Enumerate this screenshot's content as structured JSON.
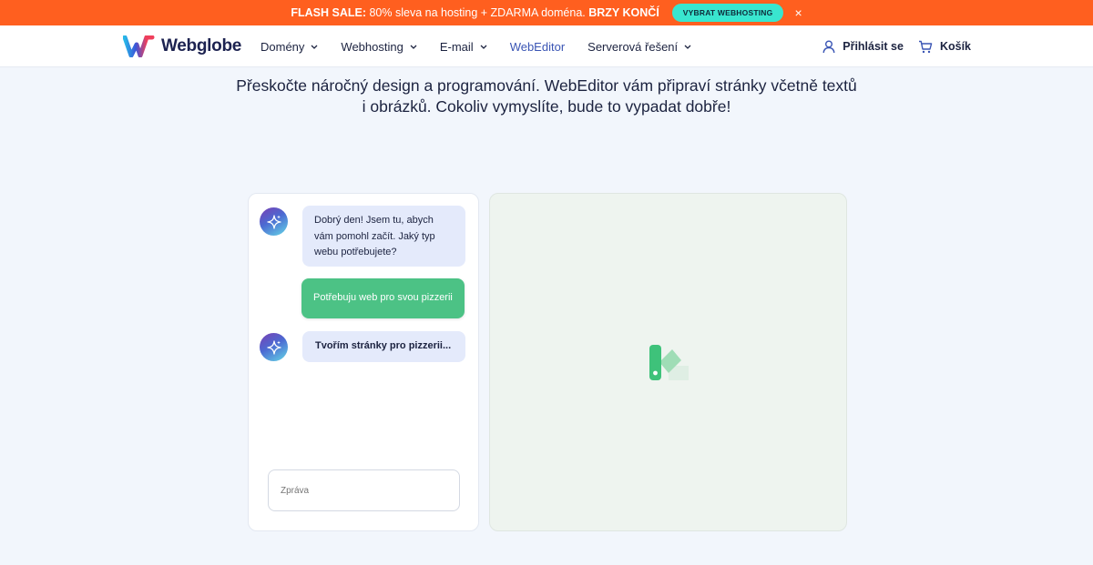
{
  "promo": {
    "text_bold_start": "FLASH SALE:",
    "text_middle": " 80% sleva na hosting + ZDARMA doména. ",
    "text_bold_end": "BRZY KONČÍ",
    "cta_label": "VYBRAT WEBHOSTING",
    "close_label": "×"
  },
  "header": {
    "logo_text": "Webglobe",
    "nav": [
      {
        "label": "Domény"
      },
      {
        "label": "Webhosting"
      },
      {
        "label": "E-mail"
      },
      {
        "label": "WebEditor"
      },
      {
        "label": "Serverová řešení"
      }
    ],
    "login_label": "Přihlásit se",
    "cart_label": "Košík"
  },
  "hero": {
    "line1": "Přeskočte náročný design a programování. WebEditor vám připraví stránky včetně textů",
    "line2": "i obrázků. Cokoliv vymyslíte, bude to vypadat dobře!"
  },
  "chat": {
    "messages": [
      {
        "role": "bot",
        "text": "Dobrý den! Jsem tu, abych vám pomohl začít. Jaký typ webu potřebujete?"
      },
      {
        "role": "user",
        "text": "Potřebuju web pro svou pizzerii"
      },
      {
        "role": "bot",
        "text": "Tvořím stránky pro pizzerii..."
      }
    ],
    "input_placeholder": "Zpráva"
  },
  "colors": {
    "promo_bg": "#ff5f1f",
    "promo_cta": "#39e6cf",
    "user_bubble": "#4cc285",
    "bot_bubble": "#e4eafb",
    "preview_bg": "#eef4ef",
    "accent_nav": "#3a55b4"
  },
  "icons": {
    "close": "close-icon",
    "user": "user-icon",
    "cart": "cart-icon",
    "sparkle": "sparkle-icon",
    "loader": "webeditor-loader-icon"
  }
}
